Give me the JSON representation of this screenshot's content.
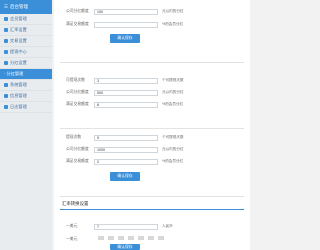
{
  "sidebar": {
    "header": "后台管理",
    "items": [
      {
        "label": "会员管理"
      },
      {
        "label": "汇率设置"
      },
      {
        "label": "交易设置"
      },
      {
        "label": "提现中心"
      },
      {
        "label": "分红设置"
      },
      {
        "label": "· 分红管理",
        "active": true
      },
      {
        "label": "系统管理"
      },
      {
        "label": "信息管理"
      },
      {
        "label": "日志管理"
      }
    ]
  },
  "block1": {
    "row1": {
      "label": "公司分红额度",
      "value": "100",
      "suffix": "元以内的分红"
    },
    "row2": {
      "label": "满足交易额度",
      "value": "",
      "suffix": "%的会员分红"
    }
  },
  "block2": {
    "row1": {
      "label": "可提现次数",
      "value": "3",
      "suffix": "个可提现天数"
    },
    "row2": {
      "label": "公司分红额度",
      "value": "500",
      "suffix": "元以内的分红"
    },
    "row3": {
      "label": "满足交易额度",
      "value": "8",
      "suffix": "%的会员分红"
    }
  },
  "block3": {
    "row1": {
      "label": "提现次数",
      "value": "5",
      "suffix": "个可提现天数"
    },
    "row2": {
      "label": "公司分红额度",
      "value": "1000",
      "suffix": "元以内的分红"
    },
    "row3": {
      "label": "满足交易额度",
      "value": "2",
      "suffix": "%的会员分红"
    }
  },
  "buttons": {
    "confirm": "确认保存"
  },
  "rate_section": {
    "title": "汇率转换设置",
    "row1": {
      "label": "一美元",
      "value": "7",
      "suffix": "人民币"
    },
    "row2": {
      "label": "一美元"
    }
  }
}
